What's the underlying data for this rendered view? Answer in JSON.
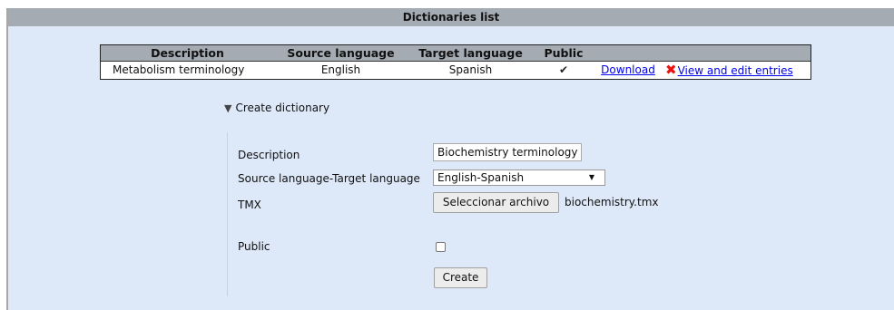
{
  "panel": {
    "title": "Dictionaries list"
  },
  "table": {
    "headers": [
      "Description",
      "Source language",
      "Target language",
      "Public"
    ],
    "rows": [
      {
        "description": "Metabolism terminology",
        "source": "English",
        "target": "Spanish",
        "public_mark": "✔",
        "download_label": "Download",
        "edit_label": "View and edit entries"
      }
    ]
  },
  "create": {
    "toggle_label": "Create dictionary",
    "description_label": "Description",
    "description_value": "Biochemistry terminology",
    "langs_label": "Source language-Target language",
    "langs_value": "English-Spanish",
    "tmx_label": "TMX",
    "file_button": "Seleccionar archivo",
    "file_name": "biochemistry.tmx",
    "public_label": "Public",
    "public_checked": false,
    "create_button": "Create"
  },
  "colors": {
    "header_bg": "#a5abb3",
    "panel_bg": "#dde8f8",
    "link": "#0000ee",
    "delete": "#e11111"
  }
}
